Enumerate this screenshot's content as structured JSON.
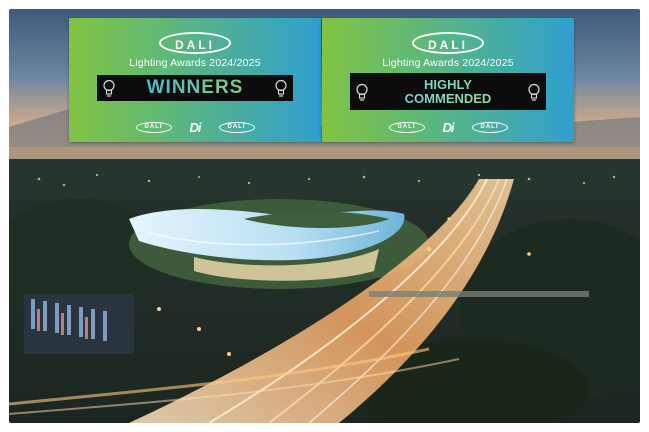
{
  "badges": [
    {
      "brand": "DALI",
      "award": "Lighting Awards 2024",
      "award_sep": "/",
      "award_end": "2025",
      "status_line1": "WINNERS",
      "partners": [
        "DALI",
        "Di",
        "DALI"
      ]
    },
    {
      "brand": "DALI",
      "award": "Lighting Awards 2024",
      "award_sep": "/",
      "award_end": "2025",
      "status_line1": "HIGHLY",
      "status_line2": "COMMENDED",
      "partners": [
        "DALI",
        "Di",
        "DALI"
      ]
    }
  ],
  "colors": {
    "badge_gradient_start": "#82c341",
    "badge_gradient_end": "#2f9fd0",
    "plate": "#0c0c0c",
    "sky_top": "#4b6a8c",
    "dusk_glow": "#f2b37a",
    "roof_glow": "#bfe3f5",
    "traffic_light": "#ffcf8a"
  },
  "icons": [
    "lightbulb-icon",
    "dali-logo",
    "di-logo"
  ]
}
